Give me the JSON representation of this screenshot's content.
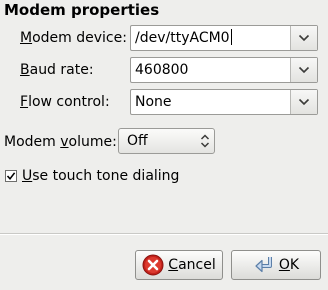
{
  "section": {
    "title": "Modem properties"
  },
  "modem_device": {
    "label_mnemonic": "M",
    "label_rest": "odem device:",
    "value": "/dev/ttyACM0"
  },
  "baud_rate": {
    "label_mnemonic": "B",
    "label_rest": "aud rate:",
    "value": "460800"
  },
  "flow_control": {
    "label_mnemonic": "F",
    "label_rest": "low control:",
    "value": "None"
  },
  "modem_volume": {
    "label_prefix": "Modem ",
    "label_mnemonic": "v",
    "label_rest": "olume:",
    "value": "Off"
  },
  "touch_tone": {
    "label_mnemonic": "U",
    "label_rest": "se touch tone dialing",
    "checked": true
  },
  "buttons": {
    "cancel_mnemonic": "C",
    "cancel_rest": "ancel",
    "ok_mnemonic": "O",
    "ok_rest": "K"
  },
  "icons": {
    "cancel": "cancel-icon",
    "ok": "ok-enter-icon",
    "dropdown": "chevron-down-icon",
    "spin": "updown-arrows-icon",
    "check": "checkmark-icon"
  }
}
